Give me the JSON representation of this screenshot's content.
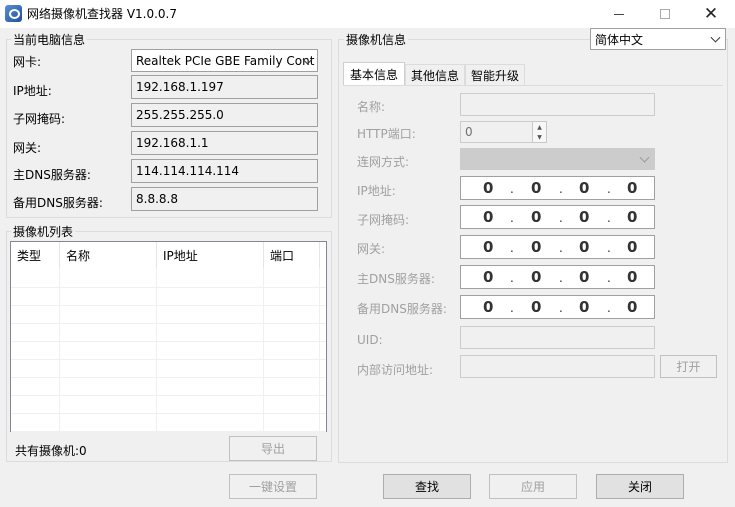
{
  "window": {
    "title": "网络摄像机查找器 V1.0.0.7",
    "controls": [
      "minimize-icon",
      "maximize-icon",
      "close-icon"
    ]
  },
  "pc_info": {
    "group_title": "当前电脑信息",
    "nic_label": "网卡:",
    "nic_value": "Realtek PCIe GBE Family Cont",
    "ip_label": "IP地址:",
    "ip_value": "192.168.1.197",
    "mask_label": "子网掩码:",
    "mask_value": "255.255.255.0",
    "gateway_label": "网关:",
    "gateway_value": "192.168.1.1",
    "dns1_label": "主DNS服务器:",
    "dns1_value": "114.114.114.114",
    "dns2_label": "备用DNS服务器:",
    "dns2_value": "8.8.8.8"
  },
  "camera_list": {
    "group_title": "摄像机列表",
    "columns": [
      "类型",
      "名称",
      "IP地址",
      "端口"
    ],
    "rows": [],
    "total_label": "共有摄像机:0",
    "export_label": "导出"
  },
  "camera_info": {
    "group_title": "摄像机信息",
    "language_value": "简体中文",
    "tabs": [
      "基本信息",
      "其他信息",
      "智能升级"
    ],
    "active_tab": 0,
    "basic": {
      "name_label": "名称:",
      "name_value": "",
      "http_port_label": "HTTP端口:",
      "http_port_value": "0",
      "net_mode_label": "连网方式:",
      "net_mode_value": "",
      "ip_label": "IP地址:",
      "mask_label": "子网掩码:",
      "gateway_label": "网关:",
      "dns1_label": "主DNS服务器:",
      "dns2_label": "备用DNS服务器:",
      "ip_octets": [
        "0",
        "0",
        "0",
        "0"
      ],
      "mask_octets": [
        "0",
        "0",
        "0",
        "0"
      ],
      "gateway_octets": [
        "0",
        "0",
        "0",
        "0"
      ],
      "dns1_octets": [
        "0",
        "0",
        "0",
        "0"
      ],
      "dns2_octets": [
        "0",
        "0",
        "0",
        "0"
      ],
      "octet_separator": ".",
      "uid_label": "UID:",
      "uid_value": "",
      "internal_addr_label": "内部访问地址:",
      "internal_addr_value": "",
      "open_label": "打开"
    }
  },
  "bottom": {
    "one_click_label": "一键设置",
    "search_label": "查找",
    "apply_label": "应用",
    "close_label": "关闭"
  }
}
